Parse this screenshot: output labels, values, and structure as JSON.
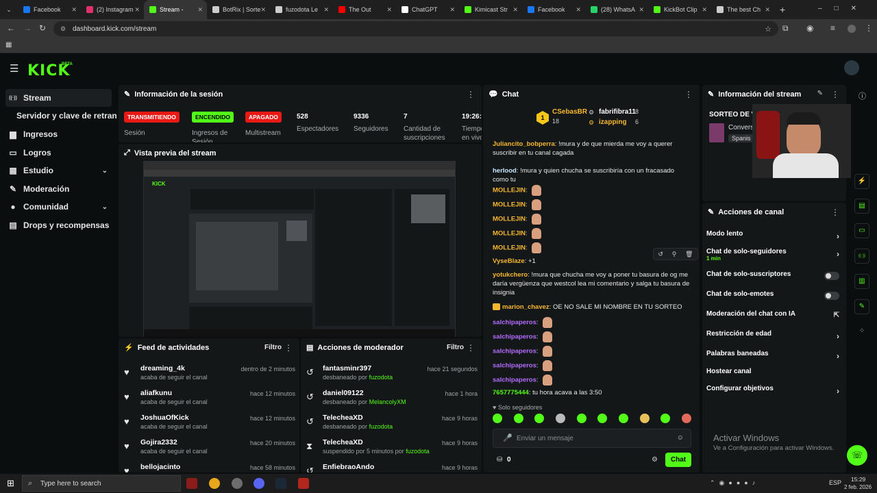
{
  "browser": {
    "tabs": [
      {
        "label": "Facebook",
        "color": "#1877f2"
      },
      {
        "label": "(2) Instagram",
        "color": "#e1306c"
      },
      {
        "label": "Stream -",
        "color": "#53fc18"
      },
      {
        "label": "BotRix | Sorte",
        "color": "#cccccc"
      },
      {
        "label": "fuzodota Le",
        "color": "#cccccc"
      },
      {
        "label": "The Out",
        "color": "#ff0000"
      },
      {
        "label": "ChatGPT",
        "color": "#ffffff"
      },
      {
        "label": "Kimicast Str",
        "color": "#53fc18"
      },
      {
        "label": "Facebook",
        "color": "#1877f2"
      },
      {
        "label": "(28) WhatsA",
        "color": "#25d366"
      },
      {
        "label": "KickBot Clip",
        "color": "#53fc18"
      },
      {
        "label": "The best Ch",
        "color": "#cccccc"
      }
    ],
    "url": "dashboard.kick.com/stream"
  },
  "logo": "KICK",
  "logo_beta": "BETA",
  "sidebar": {
    "items": [
      {
        "label": "Stream",
        "icon": "broadcast-icon"
      },
      {
        "label": "Servidor y clave de retransmisión",
        "icon": ""
      },
      {
        "label": "Ingresos",
        "icon": "money-icon"
      },
      {
        "label": "Logros",
        "icon": "trophy-icon"
      },
      {
        "label": "Estudio",
        "icon": "studio-icon"
      },
      {
        "label": "Moderación",
        "icon": "wrench-icon"
      },
      {
        "label": "Comunidad",
        "icon": "people-icon"
      },
      {
        "label": "Drops y recompensas",
        "icon": "gift-icon"
      }
    ]
  },
  "session": {
    "title": "Información de la sesión",
    "badges": [
      {
        "text": "TRANSMITIENDO",
        "label": "Sesión",
        "bg": "#e91916",
        "fg": "#ffffff"
      },
      {
        "text": "ENCENDIDO",
        "label": "Ingresos de Sesión",
        "bg": "#53fc18",
        "fg": "#000000"
      },
      {
        "text": "APAGADO",
        "label": "Multistream",
        "bg": "#e91916",
        "fg": "#ffffff"
      }
    ],
    "stats": [
      {
        "value": "528",
        "label": "Espectadores"
      },
      {
        "value": "9336",
        "label": "Seguidores"
      },
      {
        "value": "7",
        "label": "Cantidad de suscripciones"
      },
      {
        "value": "19:26:",
        "label": "Tiempo en vivo"
      }
    ]
  },
  "preview": {
    "title": "Vista previa del stream"
  },
  "feed": {
    "title": "Feed de actividades",
    "filter": "Filtro",
    "items": [
      {
        "name": "dreaming_4k",
        "desc": "acaba de seguir el canal",
        "time": "dentro de 2 minutos"
      },
      {
        "name": "aliafkunu",
        "desc": "acaba de seguir el canal",
        "time": "hace 12 minutos"
      },
      {
        "name": "JoshuaOfKick",
        "desc": "acaba de seguir el canal",
        "time": "hace 12 minutos"
      },
      {
        "name": "Gojira2332",
        "desc": "acaba de seguir el canal",
        "time": "hace 20 minutos"
      },
      {
        "name": "bellojacinto",
        "desc": "",
        "time": "hace 58 minutos"
      }
    ]
  },
  "modactions": {
    "title": "Acciones de moderador",
    "filter": "Filtro",
    "items": [
      {
        "name": "fantasminr397",
        "desc": "desbaneado por",
        "by": "fuzodota",
        "time": "hace 21 segundos",
        "icon": "undo-icon"
      },
      {
        "name": "daniel09122",
        "desc": "desbaneado por",
        "by": "MelancolyXM",
        "time": "hace 1 hora",
        "icon": "undo-icon"
      },
      {
        "name": "TelecheaXD",
        "desc": "desbaneado por",
        "by": "fuzodota",
        "time": "hace 9 horas",
        "icon": "undo-icon"
      },
      {
        "name": "TelecheaXD",
        "desc": "suspendido por 5 minutos por",
        "by": "fuzodota",
        "time": "hace 9 horas",
        "icon": "hourglass-icon"
      },
      {
        "name": "EnfiebraoAndo",
        "desc": "",
        "by": "",
        "time": "hace 9 horas",
        "icon": "undo-icon"
      }
    ]
  },
  "chat": {
    "title": "Chat",
    "top": [
      {
        "name": "CSebasBR",
        "count": "18"
      },
      {
        "name": "fabrifibra11",
        "count": "8"
      },
      {
        "name": "izapping",
        "count": "6"
      }
    ],
    "rank": "1",
    "messages": [
      {
        "user": "Juliancito_bobperra",
        "color": "#f7b731",
        "text": "!mura y de que mierda me voy a querer suscribir en tu canal cagada"
      },
      {
        "user": "herlood",
        "color": "#c7e6ff",
        "text": "!mura y quien chucha se suscribiría con un fracasado como tu"
      },
      {
        "user": "MOLLEJIN",
        "color": "#f7b731",
        "text": ""
      },
      {
        "user": "MOLLEJIN",
        "color": "#f7b731",
        "text": ""
      },
      {
        "user": "MOLLEJIN",
        "color": "#f7b731",
        "text": ""
      },
      {
        "user": "MOLLEJIN",
        "color": "#f7b731",
        "text": ""
      },
      {
        "user": "MOLLEJIN",
        "color": "#f7b731",
        "text": ""
      },
      {
        "user": "VyseBlaze",
        "color": "#f7b731",
        "text": "+1"
      },
      {
        "user": "yotukchero",
        "color": "#f7b731",
        "text": "!mura que chucha me voy a poner tu basura de og me daría vergüenza que westcol lea mi comentario y salga tu basura de insignia"
      },
      {
        "user": "marion_chavez",
        "color": "#f7b731",
        "text": "OE NO SALE MI NOMBRE EN TU SORTEO"
      },
      {
        "user": "salchipaperos",
        "color": "#b46cff",
        "text": ""
      },
      {
        "user": "salchipaperos",
        "color": "#b46cff",
        "text": ""
      },
      {
        "user": "salchipaperos",
        "color": "#b46cff",
        "text": ""
      },
      {
        "user": "salchipaperos",
        "color": "#b46cff",
        "text": ""
      },
      {
        "user": "salchipaperos",
        "color": "#b46cff",
        "text": ""
      },
      {
        "user": "7657775444",
        "color": "#53fc18",
        "text": "tu hora acava a las 3:50"
      }
    ],
    "mode": "Solo seguidores",
    "placeholder": "Enviar un mensaje",
    "points": "0",
    "send": "Chat"
  },
  "streaminfo": {
    "title": "Información del stream",
    "sorteo": "SORTEO DE VI",
    "category": "Conversa",
    "lang": "Spanis"
  },
  "channel": {
    "title": "Acciones de canal",
    "items": [
      {
        "label": "Modo lento",
        "sub": "",
        "control": "arrow"
      },
      {
        "label": "Chat de solo-seguidores",
        "sub": "1 min",
        "control": "arrow"
      },
      {
        "label": "Chat de solo-suscriptores",
        "sub": "",
        "control": "toggle"
      },
      {
        "label": "Chat de solo-emotes",
        "sub": "",
        "control": "toggle"
      },
      {
        "label": "Moderación del chat con IA",
        "sub": "",
        "control": "external"
      },
      {
        "label": "Restricción de edad",
        "sub": "",
        "control": "arrow"
      },
      {
        "label": "Palabras baneadas",
        "sub": "",
        "control": "arrow"
      },
      {
        "label": "Hostear canal",
        "sub": "",
        "control": "none"
      },
      {
        "label": "Configurar objetivos",
        "sub": "",
        "control": "arrow"
      }
    ]
  },
  "watermark": {
    "title": "Activar Windows",
    "sub": "Ve a Configuración para activar Windows."
  },
  "taskbar": {
    "search": "Type here to search",
    "time": "15:29",
    "date": "2 feb. 2026",
    "lang": "ESP"
  }
}
